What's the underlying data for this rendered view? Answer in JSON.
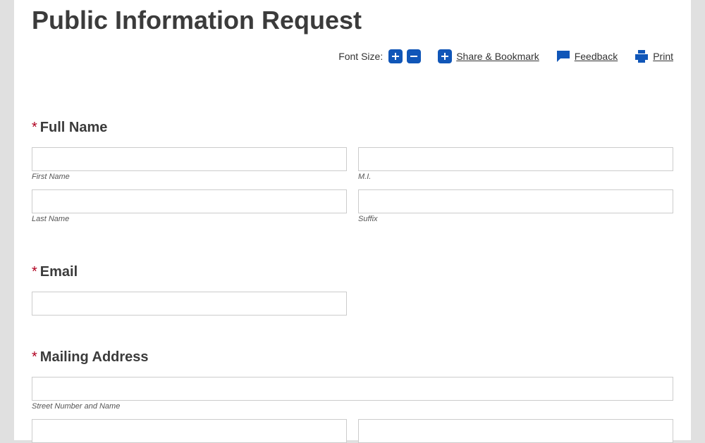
{
  "page": {
    "title": "Public Information Request"
  },
  "tools": {
    "fontsize_label": "Font Size:",
    "share_label": "Share & Bookmark",
    "feedback_label": "Feedback",
    "print_label": "Print"
  },
  "form": {
    "fullname": {
      "heading": "Full Name",
      "first_label": "First Name",
      "mi_label": "M.I.",
      "last_label": "Last Name",
      "suffix_label": "Suffix"
    },
    "email": {
      "heading": "Email"
    },
    "address": {
      "heading": "Mailing Address",
      "street_label": "Street Number and Name"
    }
  }
}
